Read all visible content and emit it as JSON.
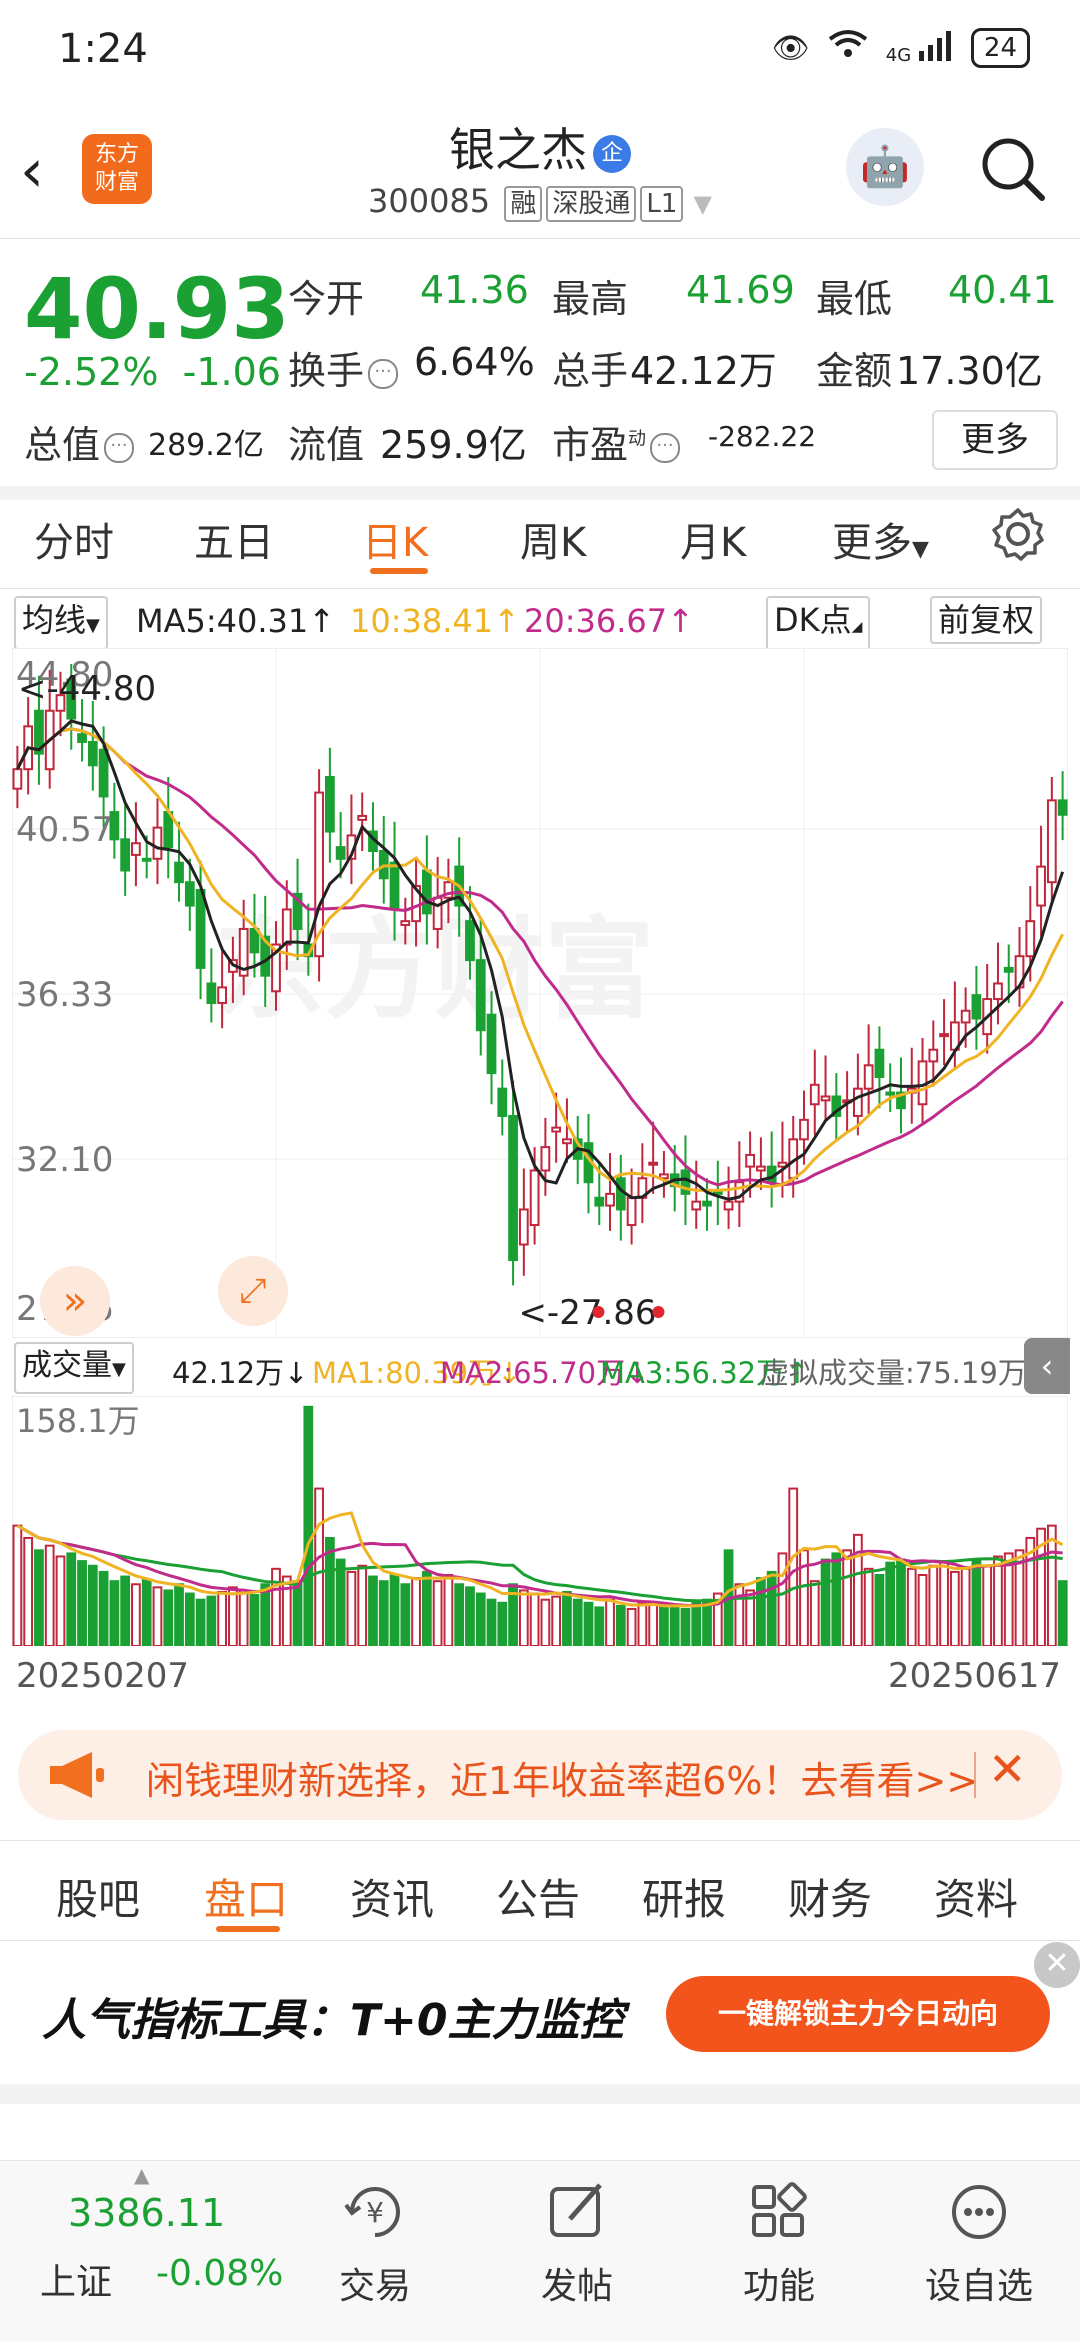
{
  "status": {
    "time": "1:24",
    "net": "4G",
    "battery": "24"
  },
  "header": {
    "back_glyph": "‹",
    "logo_text": [
      "东方",
      "财富"
    ],
    "stock_name": "银之杰",
    "tag": "企",
    "code": "300085",
    "tags": [
      "融",
      "深股通",
      "L1"
    ]
  },
  "quote": {
    "price": "40.93",
    "change_pct": "-2.52%",
    "change_abs": "-1.06",
    "fields": [
      {
        "label": "今开",
        "value": "41.36"
      },
      {
        "label": "最高",
        "value": "41.69"
      },
      {
        "label": "最低",
        "value": "40.41"
      },
      {
        "label": "换手",
        "value": "6.64%"
      },
      {
        "label": "总手",
        "value": "42.12万"
      },
      {
        "label": "金额",
        "value": "17.30亿"
      },
      {
        "label": "总值",
        "value": "289.2亿"
      },
      {
        "label": "流值",
        "value": "259.9亿"
      },
      {
        "label": "市盈",
        "sup": "动",
        "value": "-282.22"
      }
    ],
    "more": "更多"
  },
  "period_tabs": [
    "分时",
    "五日",
    "日K",
    "周K",
    "月K",
    "更多"
  ],
  "active_period": "日K",
  "ma_row": {
    "selector": "均线",
    "ma5": "MA5:40.31↑",
    "ma10": "10:38.41↑",
    "ma20": "20:36.67↑",
    "dk": "DK点",
    "adjust": "前复权"
  },
  "colors": {
    "up": "#c0263c",
    "down": "#1aa033",
    "ma5": "#222222",
    "ma10": "#f0b323",
    "ma20": "#c02b8c",
    "accent": "#f0701f"
  },
  "chart_data": [
    {
      "type": "candlestick",
      "title": "",
      "ylim": [
        27.86,
        44.8
      ],
      "y_ticks": [
        "44.80",
        "40.57",
        "36.33",
        "32.10",
        "27.86"
      ],
      "high_marker": "<-44.80",
      "low_marker": "<-27.86",
      "x_range_labels": [
        "20250207",
        "20250617"
      ],
      "watermark": "东方财富",
      "closes": [
        42.1,
        43.2,
        42.5,
        43.6,
        44.0,
        43.4,
        42.8,
        42.2,
        41.4,
        40.3,
        39.5,
        40.2,
        39.8,
        40.6,
        40.1,
        39.2,
        38.6,
        37.0,
        36.1,
        36.5,
        37.2,
        38.0,
        37.4,
        36.8,
        37.6,
        38.5,
        38.0,
        37.3,
        41.5,
        40.5,
        39.8,
        40.4,
        40.9,
        40.0,
        39.3,
        38.5,
        38.2,
        39.1,
        38.4,
        38.8,
        39.2,
        38.6,
        37.2,
        35.4,
        34.3,
        33.2,
        29.5,
        30.8,
        31.8,
        32.4,
        32.9,
        32.6,
        32.1,
        31.5,
        30.9,
        31.2,
        30.8,
        31.1,
        31.6,
        32.0,
        31.7,
        31.4,
        31.2,
        31.0,
        30.9,
        31.2,
        31.0,
        31.5,
        32.2,
        31.9,
        31.5,
        32.0,
        32.6,
        33.1,
        34.0,
        33.7,
        33.2,
        33.6,
        33.9,
        34.5,
        34.2,
        33.8,
        33.4,
        33.9,
        34.6,
        34.9,
        35.3,
        35.6,
        35.9,
        35.7,
        36.2,
        36.6,
        36.9,
        37.3,
        38.2,
        39.6,
        41.3,
        40.93
      ],
      "ma5_last": "40.31",
      "ma10_last": "38.41",
      "ma20_last": "36.67"
    },
    {
      "type": "bar",
      "title": "",
      "ylim": [
        0,
        158.1
      ],
      "y_max_label": "158.1万",
      "selector": "成交量",
      "current": "42.12万↓",
      "ma1": "MA1:80.39万↓",
      "ma2": "MA2:65.70万↓",
      "ma3": "MA3:56.32万↑",
      "virtual": "虚拟成交量:75.19万",
      "values": [
        78,
        70,
        62,
        65,
        58,
        60,
        55,
        52,
        48,
        42,
        45,
        40,
        43,
        38,
        36,
        40,
        34,
        30,
        32,
        35,
        38,
        36,
        33,
        40,
        50,
        45,
        42,
        155,
        102,
        70,
        56,
        48,
        52,
        45,
        42,
        46,
        40,
        44,
        48,
        42,
        46,
        40,
        38,
        34,
        30,
        28,
        40,
        36,
        34,
        30,
        32,
        35,
        30,
        28,
        25,
        30,
        26,
        24,
        28,
        27,
        25,
        26,
        24,
        28,
        30,
        34,
        62,
        40,
        36,
        44,
        48,
        60,
        102,
        62,
        42,
        56,
        60,
        62,
        72,
        50,
        46,
        54,
        56,
        50,
        46,
        52,
        55,
        48,
        50,
        55,
        52,
        58,
        60,
        62,
        70,
        76,
        78,
        42
      ]
    }
  ],
  "banner": {
    "text": "闲钱理财新选择，近1年收益率超6%！去看看>>"
  },
  "section_tabs": [
    "股吧",
    "盘口",
    "资讯",
    "公告",
    "研报",
    "财务",
    "资料"
  ],
  "active_section": "盘口",
  "ad": {
    "title": "人气指标工具：T+0主力监控",
    "cta": "一键解锁主力今日动向"
  },
  "bottom_nav": {
    "index_value": "3386.11",
    "index_name": "上证",
    "index_change": "-0.08%",
    "items": [
      "交易",
      "发帖",
      "功能",
      "设自选"
    ]
  }
}
